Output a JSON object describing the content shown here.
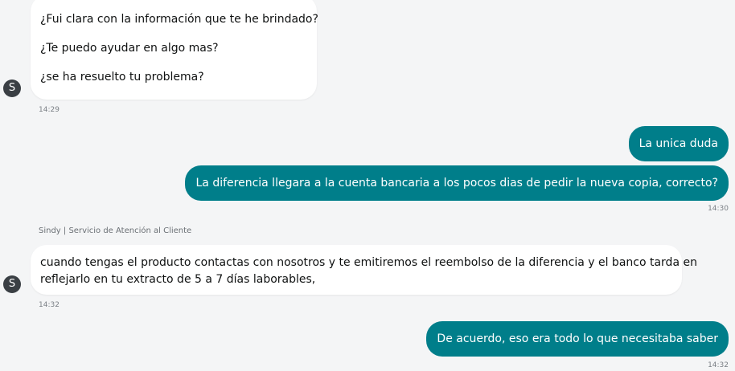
{
  "messages": {
    "m1": {
      "lines": [
        "¿Fui clara con la información que te he brindado?",
        "¿Te puedo ayudar en algo mas?",
        "¿se ha resuelto tu problema?"
      ],
      "time": "14:29"
    },
    "m2": {
      "text": "La unica duda"
    },
    "m3": {
      "text": "La diferencia llegara a la cuenta bancaria a los pocos dias de pedir la nueva copia, correcto?",
      "time": "14:30"
    },
    "agent_label": "Sindy | Servicio de Atención al Cliente",
    "m4": {
      "lines": [
        "cuando tengas el producto contactas con nosotros y te emitiremos el reembolso de la diferencia y el banco tarda en",
        "reflejarlo  en tu extracto de 5 a 7 días laborables,"
      ],
      "time": "14:32"
    },
    "m5": {
      "text": "De acuerdo, eso era todo lo que necesitaba saber",
      "time": "14:32"
    }
  },
  "avatar": {
    "initial": "S"
  },
  "colors": {
    "outgoing_bubble": "#007e8a",
    "incoming_bubble": "#ffffff",
    "background": "#f4f5f6",
    "avatar": "#3a3f44"
  }
}
